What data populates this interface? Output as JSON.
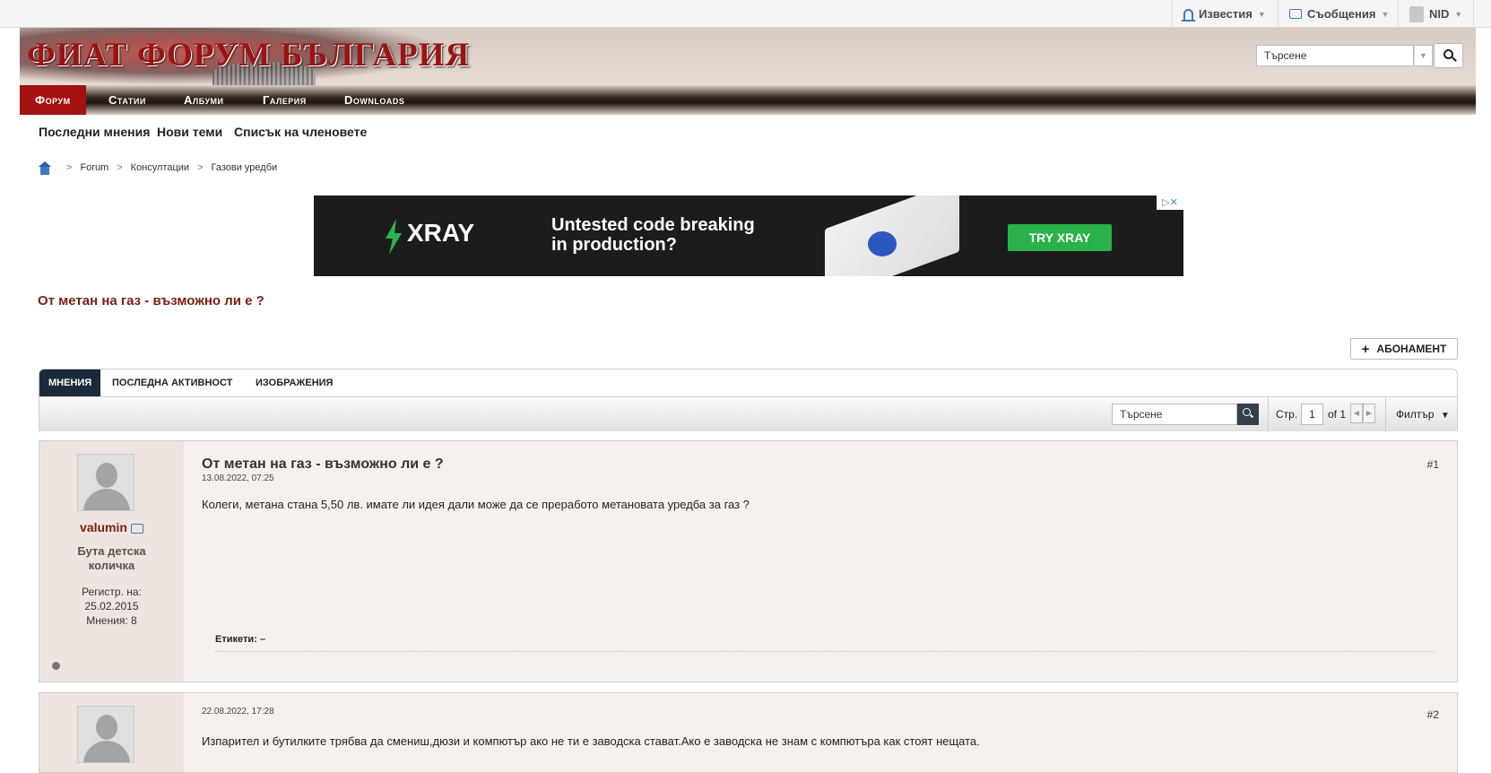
{
  "topbar": {
    "notifications": "Известия",
    "messages": "Съобщения",
    "user": "NID",
    "arrow": "▼"
  },
  "site": {
    "logo_text": "ФИАТ ФОРУМ БЪЛГАРИЯ",
    "search_placeholder": "Търсене"
  },
  "nav": {
    "items": [
      "Форум",
      "Статии",
      "Албуми",
      "Галерия",
      "Downloads"
    ]
  },
  "subnav": [
    "Последни мнения",
    "Нови теми",
    "Списък на членовете"
  ],
  "breadcrumb": [
    "Forum",
    "Консултации",
    "Газови уредби"
  ],
  "ad": {
    "brand": "XRAY",
    "headline_1": "Untested code breaking",
    "headline_2": "in production?",
    "cta": "TRY XRAY"
  },
  "thread": {
    "title": "От метан на газ - възможно ли е ?",
    "subscribe": "АБОНАМЕНТ"
  },
  "tabs": [
    "МНЕНИЯ",
    "ПОСЛЕДНА АКТИВНОСТ",
    "ИЗОБРАЖЕНИЯ"
  ],
  "toolbar": {
    "search_placeholder": "Търсене",
    "page_label": "Стр.",
    "page_value": "1",
    "of_label": "of 1",
    "filter": "Филтър"
  },
  "posts": [
    {
      "title": "От метан на газ - възможно ли е ?",
      "date": "13.08.2022, 07:25",
      "num": "#1",
      "text": "Колеги, метана стана 5,50 лв. имате ли идея дали може да се преработо метановата уредба за газ ?",
      "username": "valumin",
      "user_title_1": "Бута детска",
      "user_title_2": "количка",
      "reg_label": "Регистр. на:",
      "reg_date": "25.02.2015",
      "posts_count": "Мнения: 8",
      "tags": "Етикети: –"
    },
    {
      "date": "22.08.2022, 17:28",
      "num": "#2",
      "text": "Изпарител и бутилките трябва да смениш,дюзи и компютър ако не ти е заводска стават.Ако е заводска не знам с компютъра как стоят нещата."
    }
  ]
}
